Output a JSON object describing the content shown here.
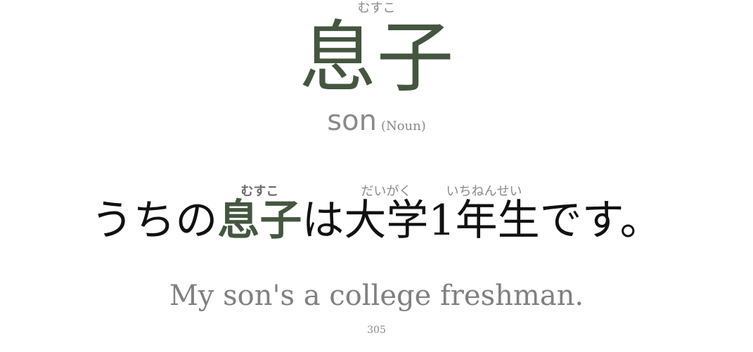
{
  "card": {
    "reading": "むすこ",
    "word": "息子",
    "gloss": "son",
    "part_of_speech": "(Noun)"
  },
  "example": {
    "segments": {
      "pre": "うちの",
      "target": "息子",
      "target_reading": "むすこ",
      "particle": "は",
      "daigaku": "大学",
      "daigaku_reading": "だいがく",
      "ichinensei": "1年生",
      "ichinensei_reading": "いちねんせい",
      "end": "です。"
    },
    "translation": "My son's a college freshman."
  },
  "page_number": "305",
  "colors": {
    "accent": "#44563f",
    "muted": "#8a8a8a",
    "text": "#111111"
  }
}
